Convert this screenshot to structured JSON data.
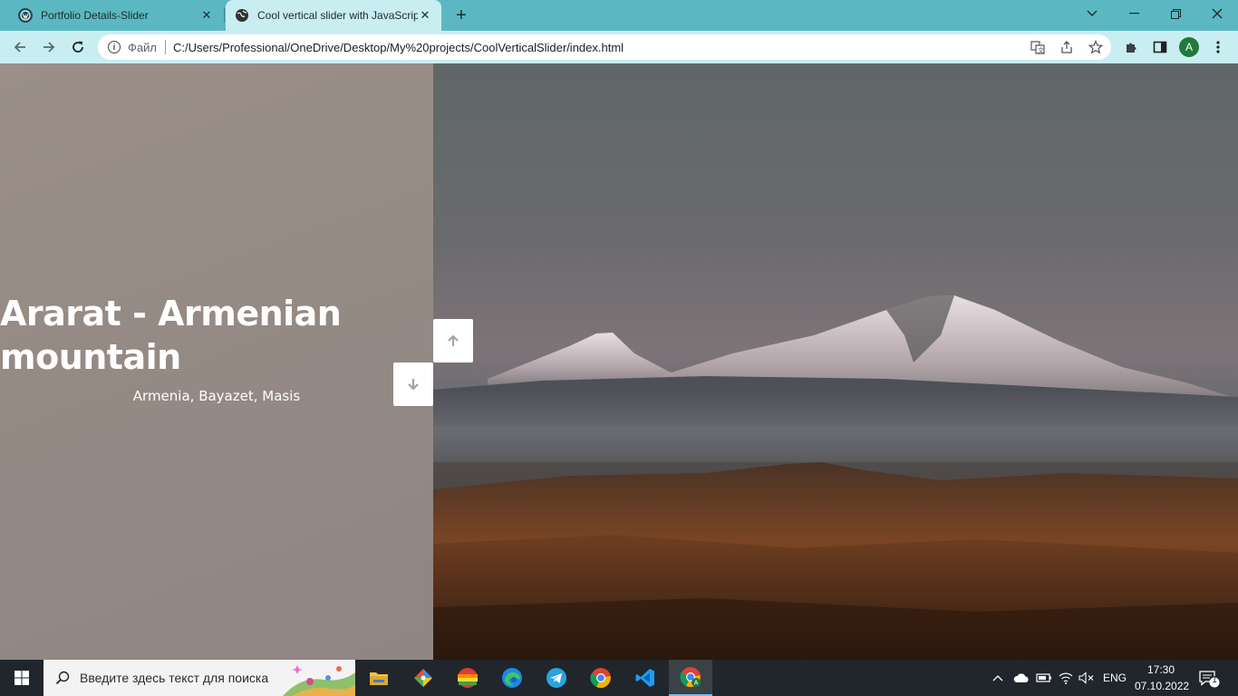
{
  "browser": {
    "tabs": [
      {
        "title": "Portfolio Details-Slider",
        "icon": "wordpress-icon",
        "active": false
      },
      {
        "title": "Cool vertical slider with JavaScript",
        "icon": "globe-icon",
        "active": true
      }
    ],
    "new_tab": "+",
    "address_bar": {
      "security_label": "Файл",
      "url": "C:/Users/Professional/OneDrive/Desktop/My%20projects/CoolVerticalSlider/index.html"
    },
    "profile_initial": "A"
  },
  "slider": {
    "title": "Ararat - Armenian mountain",
    "subtitle": "Armenia, Bayazet, Masis",
    "up_button_icon": "arrow-up-icon",
    "down_button_icon": "arrow-down-icon"
  },
  "taskbar": {
    "search_placeholder": "Введите здесь текст для поиска",
    "language": "ENG",
    "time": "17:30",
    "date": "07.10.2022",
    "notification_count": "1",
    "apps": [
      "file-explorer-icon",
      "git-icon",
      "app-icon",
      "edge-icon",
      "telegram-icon",
      "chrome-icon",
      "vscode-icon",
      "chrome-profile-icon"
    ]
  },
  "colors": {
    "tab_bar": "#5bb8c2",
    "toolbar": "#c9eef2",
    "left_panel": "#958a84",
    "taskbar": "#20262b"
  }
}
